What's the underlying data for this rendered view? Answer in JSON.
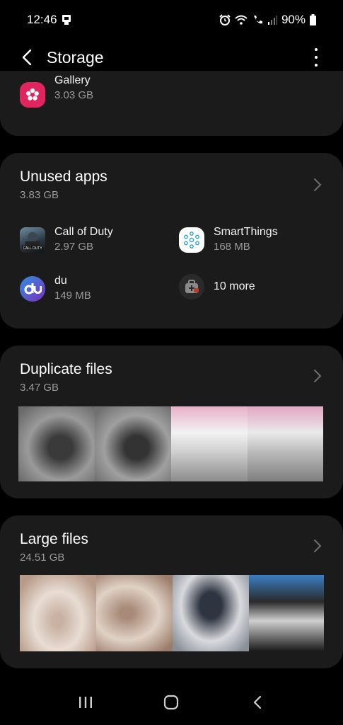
{
  "status_bar": {
    "time": "12:46",
    "battery": "90%",
    "icons": [
      "notification-icon",
      "alarm-icon",
      "wifi-icon",
      "wifi-calling-icon",
      "signal-icon",
      "battery-icon"
    ]
  },
  "app_bar": {
    "title": "Storage",
    "back_icon": "back-arrow-icon",
    "more_icon": "more-options-icon"
  },
  "gallery": {
    "name": "Gallery",
    "size": "3.03 GB",
    "icon": "gallery-icon",
    "icon_color": "#e0245e"
  },
  "unused_apps": {
    "title": "Unused apps",
    "size": "3.83 GB",
    "apps": [
      {
        "name": "Call of Duty",
        "size": "2.97 GB",
        "icon": "call-of-duty-icon"
      },
      {
        "name": "SmartThings",
        "size": "168 MB",
        "icon": "smartthings-icon"
      },
      {
        "name": "du",
        "size": "149 MB",
        "icon": "du-icon"
      }
    ],
    "more_label": "10 more"
  },
  "duplicate_files": {
    "title": "Duplicate files",
    "size": "3.47 GB"
  },
  "large_files": {
    "title": "Large files",
    "size": "24.51 GB"
  },
  "nav_bar": {
    "items": [
      "recent-apps-icon",
      "home-icon",
      "back-icon"
    ]
  },
  "colors": {
    "background": "#000000",
    "card": "#1b1b1b",
    "secondary_text": "#9a9a9a",
    "du_gradient_start": "#2f8fe0",
    "du_gradient_end": "#7b2fbf"
  }
}
